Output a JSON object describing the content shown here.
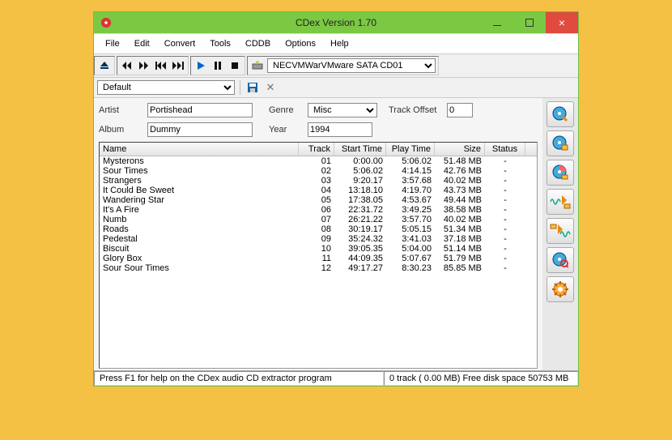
{
  "window": {
    "title": "CDex Version 1.70"
  },
  "menu": [
    "File",
    "Edit",
    "Convert",
    "Tools",
    "CDDB",
    "Options",
    "Help"
  ],
  "drive": "NECVMWarVMware SATA CD01",
  "profile": "Default",
  "form": {
    "artist_label": "Artist",
    "artist": "Portishead",
    "album_label": "Album",
    "album": "Dummy",
    "genre_label": "Genre",
    "genre": "Misc",
    "year_label": "Year",
    "year": "1994",
    "offset_label": "Track Offset",
    "offset": "0"
  },
  "columns": {
    "name": "Name",
    "track": "Track",
    "start": "Start Time",
    "play": "Play Time",
    "size": "Size",
    "status": "Status"
  },
  "tracks": [
    {
      "name": "Mysterons",
      "track": "01",
      "start": "0:00.00",
      "play": "5:06.02",
      "size": "51.48 MB",
      "status": "-"
    },
    {
      "name": "Sour Times",
      "track": "02",
      "start": "5:06.02",
      "play": "4:14.15",
      "size": "42.76 MB",
      "status": "-"
    },
    {
      "name": "Strangers",
      "track": "03",
      "start": "9:20.17",
      "play": "3:57.68",
      "size": "40.02 MB",
      "status": "-"
    },
    {
      "name": "It Could Be Sweet",
      "track": "04",
      "start": "13:18.10",
      "play": "4:19.70",
      "size": "43.73 MB",
      "status": "-"
    },
    {
      "name": "Wandering Star",
      "track": "05",
      "start": "17:38.05",
      "play": "4:53.67",
      "size": "49.44 MB",
      "status": "-"
    },
    {
      "name": "It's A Fire",
      "track": "06",
      "start": "22:31.72",
      "play": "3:49.25",
      "size": "38.58 MB",
      "status": "-"
    },
    {
      "name": "Numb",
      "track": "07",
      "start": "26:21.22",
      "play": "3:57.70",
      "size": "40.02 MB",
      "status": "-"
    },
    {
      "name": "Roads",
      "track": "08",
      "start": "30:19.17",
      "play": "5:05.15",
      "size": "51.34 MB",
      "status": "-"
    },
    {
      "name": "Pedestal",
      "track": "09",
      "start": "35:24.32",
      "play": "3:41.03",
      "size": "37.18 MB",
      "status": "-"
    },
    {
      "name": "Biscuit",
      "track": "10",
      "start": "39:05.35",
      "play": "5:04.00",
      "size": "51.14 MB",
      "status": "-"
    },
    {
      "name": "Glory Box",
      "track": "11",
      "start": "44:09.35",
      "play": "5:07.67",
      "size": "51.79 MB",
      "status": "-"
    },
    {
      "name": "Sour Sour Times",
      "track": "12",
      "start": "49:17.27",
      "play": "8:30.23",
      "size": "85.85 MB",
      "status": "-"
    }
  ],
  "status": {
    "help": "Press F1 for help on the CDex audio CD extractor program",
    "info": "0 track ( 0.00 MB) Free disk space 50753 MB"
  }
}
